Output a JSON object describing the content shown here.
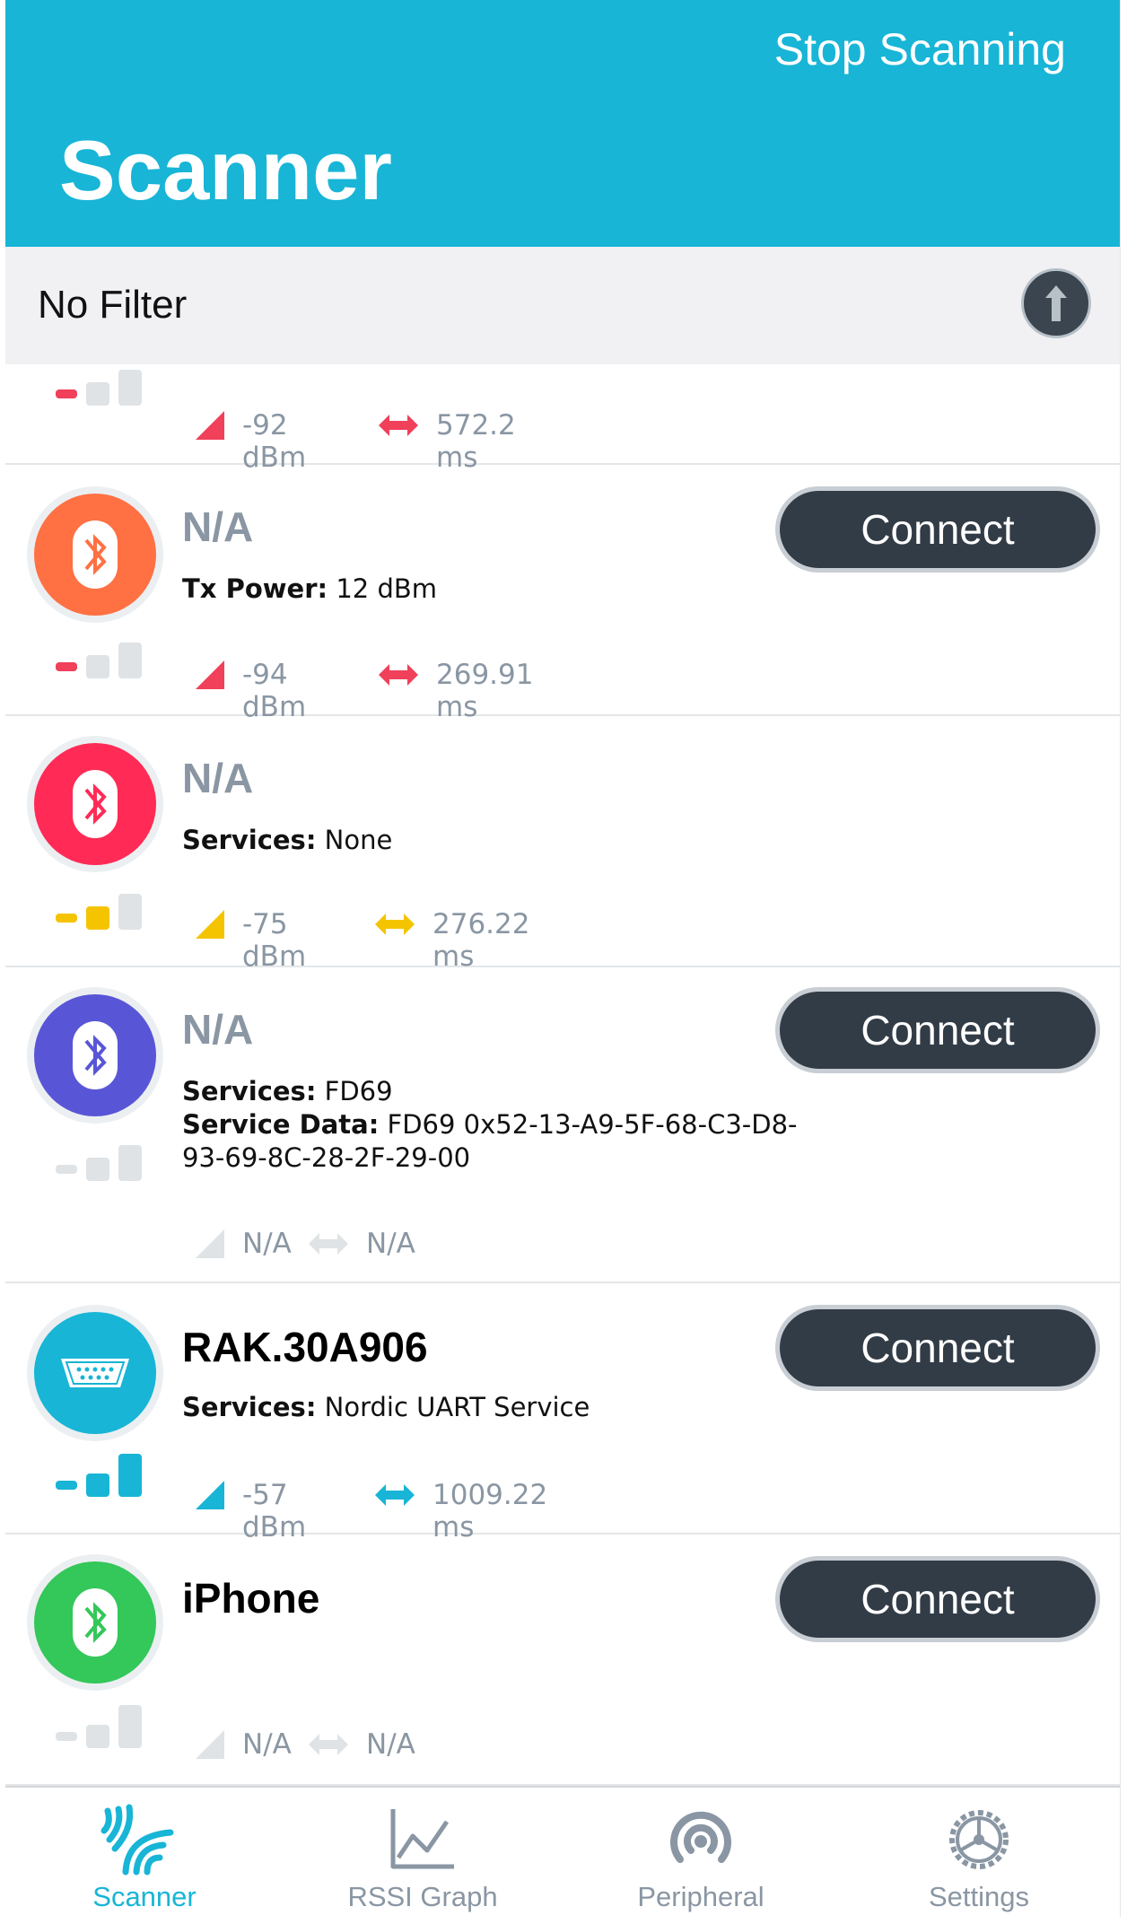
{
  "header": {
    "stop_label": "Stop Scanning",
    "title": "Scanner"
  },
  "filter": {
    "label": "No Filter"
  },
  "devices": [
    {
      "name": "",
      "info": [],
      "rssi": "-92 dBm",
      "interval": "572.2 ms",
      "signal_level": 1,
      "signal_color": "#f0405a"
    },
    {
      "name": "N/A",
      "info": [
        {
          "key": "Tx Power:",
          "value": " 12 dBm"
        }
      ],
      "rssi": "-94 dBm",
      "interval": "269.91 ms",
      "avatar_color": "#ff7043",
      "icon": "bluetooth-icon",
      "signal_level": 1,
      "signal_color": "#f0405a",
      "connect_label": "Connect"
    },
    {
      "name": "N/A",
      "info": [
        {
          "key": "Services:",
          "value": " None"
        }
      ],
      "rssi": "-75 dBm",
      "interval": "276.22 ms",
      "avatar_color": "#ff2b56",
      "icon": "bluetooth-icon",
      "signal_level": 2,
      "signal_color": "#f5c400"
    },
    {
      "name": "N/A",
      "info": [
        {
          "key": "Services:",
          "value": " FD69"
        },
        {
          "key": "Service Data:",
          "value": " FD69 0x52-13-A9-5F-68-C3-D8-93-69-8C-28-2F-29-00"
        }
      ],
      "rssi": "N/A",
      "interval": "N/A",
      "avatar_color": "#5856d6",
      "icon": "bluetooth-icon",
      "signal_level": 0,
      "signal_color": "#dfe3e6",
      "connect_label": "Connect"
    },
    {
      "name": "RAK.30A906",
      "info": [
        {
          "key": "Services:",
          "value": " Nordic UART Service"
        }
      ],
      "rssi": "-57 dBm",
      "interval": "1009.22 ms",
      "avatar_color": "#18b5d6",
      "icon": "serial-port-icon",
      "signal_level": 3,
      "signal_color": "#18b5d6",
      "connect_label": "Connect"
    },
    {
      "name": "iPhone",
      "info": [],
      "rssi": "N/A",
      "interval": "N/A",
      "avatar_color": "#34c759",
      "icon": "bluetooth-icon",
      "signal_level": 0,
      "signal_color": "#dfe3e6",
      "connect_label": "Connect"
    }
  ],
  "tabs": [
    {
      "label": "Scanner",
      "icon": "scanner-waves-icon",
      "active": true
    },
    {
      "label": "RSSI Graph",
      "icon": "graph-icon",
      "active": false
    },
    {
      "label": "Peripheral",
      "icon": "broadcast-icon",
      "active": false
    },
    {
      "label": "Settings",
      "icon": "gear-icon",
      "active": false
    }
  ],
  "colors": {
    "accent": "#18b5d6",
    "button_dark": "#323c47",
    "muted_text": "#8a96a3"
  }
}
